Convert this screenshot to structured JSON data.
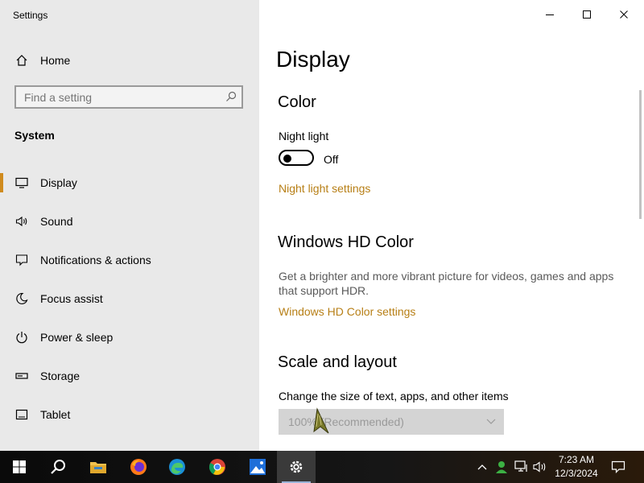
{
  "window": {
    "app_title": "Settings",
    "minimize_icon": "minimize-icon",
    "maximize_icon": "maximize-icon",
    "close_icon": "close-icon"
  },
  "sidebar": {
    "home_label": "Home",
    "search_placeholder": "Find a setting",
    "section_heading": "System",
    "active_accent": "#d08b1e",
    "items": [
      {
        "label": "Display",
        "icon": "monitor-icon",
        "active": true
      },
      {
        "label": "Sound",
        "icon": "speaker-icon"
      },
      {
        "label": "Notifications & actions",
        "icon": "notification-icon"
      },
      {
        "label": "Focus assist",
        "icon": "moon-icon"
      },
      {
        "label": "Power & sleep",
        "icon": "power-icon"
      },
      {
        "label": "Storage",
        "icon": "storage-icon"
      },
      {
        "label": "Tablet",
        "icon": "tablet-icon"
      }
    ]
  },
  "main": {
    "title": "Display",
    "color": {
      "heading": "Color",
      "night_light_label": "Night light",
      "night_light_state": "Off",
      "night_light_link": "Night light settings"
    },
    "hd_color": {
      "heading": "Windows HD Color",
      "description": "Get a brighter and more vibrant picture for videos, games and apps that support HDR.",
      "link": "Windows HD Color settings"
    },
    "scale_layout": {
      "heading": "Scale and layout",
      "change_size_label": "Change the size of text, apps, and other items",
      "scale_value": "100% (Recommended)"
    },
    "link_color": "#b77f16"
  },
  "taskbar": {
    "apps": [
      "start-icon",
      "search-icon",
      "file-explorer-icon",
      "firefox-icon",
      "edge-icon",
      "chrome-icon",
      "photos-icon",
      "settings-icon"
    ],
    "active_app": "settings-icon",
    "tray_icons": [
      "chevron-up-icon",
      "user-icon",
      "network-icon",
      "volume-icon",
      "notification-center-icon"
    ],
    "time": "7:23 AM",
    "date": "12/3/2024"
  }
}
